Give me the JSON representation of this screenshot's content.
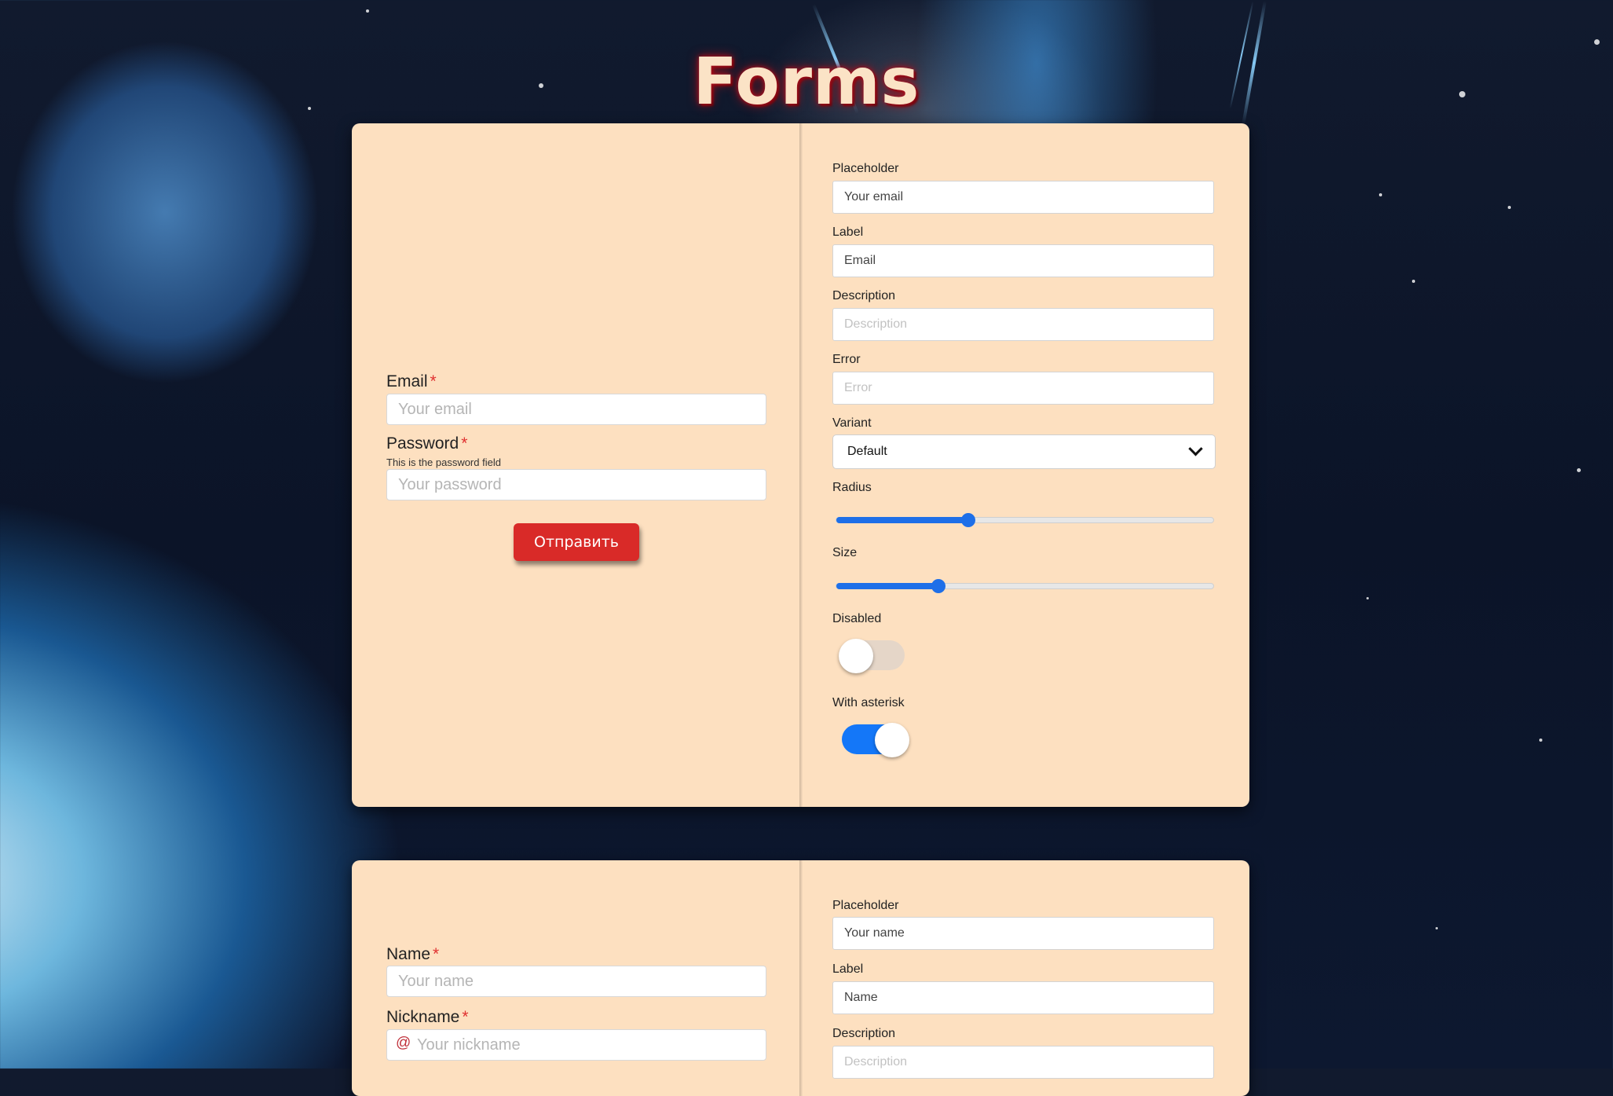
{
  "page": {
    "title": "Forms"
  },
  "forms": [
    {
      "fields": [
        {
          "label": "Email",
          "required": "*",
          "placeholder": "Your email"
        },
        {
          "label": "Password",
          "required": "*",
          "description": "This is the password field",
          "placeholder": "Your password"
        }
      ],
      "submit_label": "Отправить",
      "config": {
        "placeholder": {
          "label": "Placeholder",
          "value": "Your email"
        },
        "label": {
          "label": "Label",
          "value": "Email"
        },
        "description": {
          "label": "Description",
          "placeholder": "Description"
        },
        "error": {
          "label": "Error",
          "placeholder": "Error"
        },
        "variant": {
          "label": "Variant",
          "value": "Default"
        },
        "radius": {
          "label": "Radius",
          "value_fraction": 0.35
        },
        "size": {
          "label": "Size",
          "value_fraction": 0.27
        },
        "disabled": {
          "label": "Disabled",
          "on": false
        },
        "with_asterisk": {
          "label": "With asterisk",
          "on": true
        }
      }
    },
    {
      "fields": [
        {
          "label": "Name",
          "required": "*",
          "placeholder": "Your name"
        },
        {
          "label": "Nickname",
          "required": "*",
          "placeholder": "Your nickname",
          "icon": "@"
        }
      ],
      "config": {
        "placeholder": {
          "label": "Placeholder",
          "value": "Your name"
        },
        "label": {
          "label": "Label",
          "value": "Name"
        },
        "description": {
          "label": "Description",
          "placeholder": "Description"
        }
      }
    }
  ],
  "colors": {
    "card_bg": "#fde0c0",
    "accent": "#1e6fe8",
    "submit": "#d92a28",
    "required": "#e03131"
  }
}
